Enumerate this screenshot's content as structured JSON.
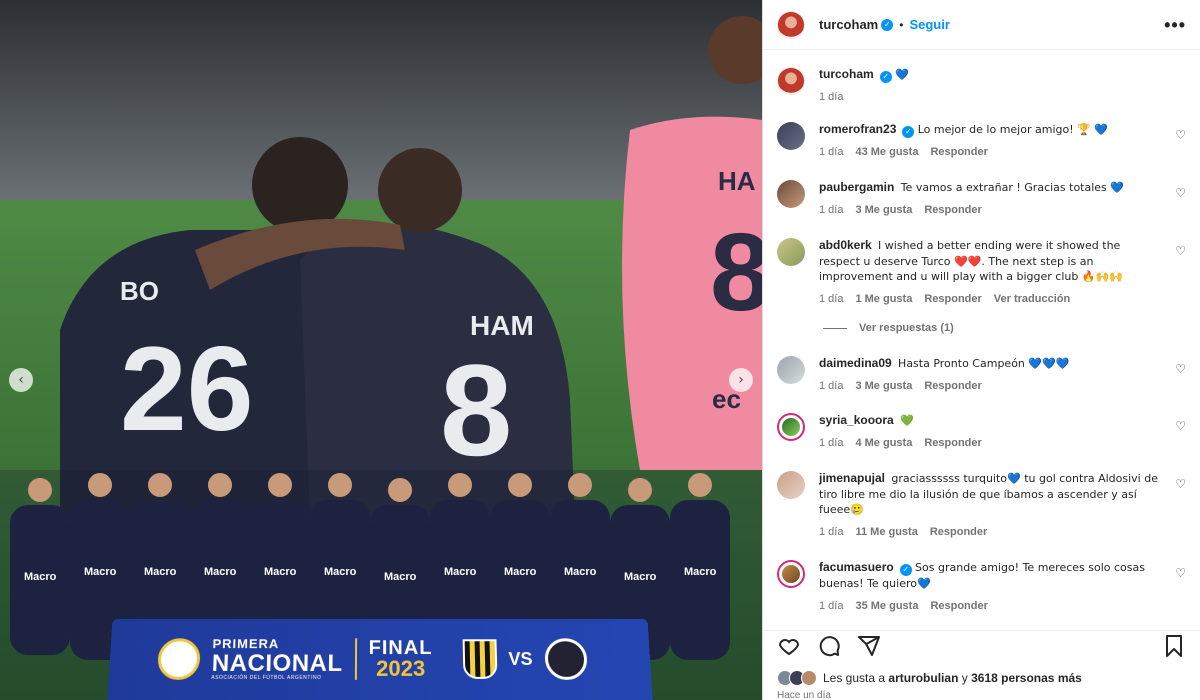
{
  "post": {
    "author": "turcoham",
    "follow_label": "Seguir",
    "more_label": "•••",
    "dot": "•",
    "verified_mark": "✓"
  },
  "media": {
    "prev_arrow": "‹",
    "next_arrow": "›",
    "jersey_left_number": "26",
    "jersey_right_number": "8",
    "jersey_right_name": "HAM",
    "jersey_left_name": "BO",
    "pink_jersey_name": "HA",
    "pink_jersey_number": "8",
    "pink_sponsor": "ec",
    "shirt_sponsor": "Macro",
    "banner": {
      "line1": "PRIMERA",
      "line2": "NACIONAL",
      "line3": "ASOCIACIÓN DEL FÚTBOL ARGENTINO",
      "final": "FINAL",
      "year": "2023",
      "vs": "VS"
    }
  },
  "caption": {
    "username": "turcoham",
    "text": "💙",
    "time": "1 día"
  },
  "comments": [
    {
      "username": "romerofran23",
      "verified": true,
      "text": "Lo mejor de lo mejor amigo! 🏆 💙",
      "time": "1 día",
      "likes": "43 Me gusta",
      "reply": "Responder",
      "extra": ""
    },
    {
      "username": "paubergamin",
      "verified": false,
      "text": "Te vamos a extrañar ! Gracias totales 💙",
      "time": "1 día",
      "likes": "3 Me gusta",
      "reply": "Responder",
      "extra": ""
    },
    {
      "username": "abd0kerk",
      "verified": false,
      "text": "I wished a better ending were it showed the respect u deserve Turco ❤️❤️. The next step is an improvement and u will play with a bigger club 🔥🙌🙌",
      "time": "1 día",
      "likes": "1 Me gusta",
      "reply": "Responder",
      "extra": "Ver traducción"
    },
    {
      "username": "daimedina09",
      "verified": false,
      "text": "Hasta Pronto Campeón 💙💙💙",
      "time": "1 día",
      "likes": "3 Me gusta",
      "reply": "Responder",
      "extra": ""
    },
    {
      "username": "syria_kooora",
      "verified": false,
      "text": "💚",
      "time": "1 día",
      "likes": "4 Me gusta",
      "reply": "Responder",
      "extra": ""
    },
    {
      "username": "jimenapujal",
      "verified": false,
      "text": "graciassssss turquito💙 tu gol contra Aldosivi de tiro libre me dio la ilusión de que íbamos a ascender y así fueee🥲",
      "time": "1 día",
      "likes": "11 Me gusta",
      "reply": "Responder",
      "extra": ""
    },
    {
      "username": "facumasuero",
      "verified": true,
      "text": "Sos grande amigo! Te mereces solo cosas buenas! Te quiero💙",
      "time": "1 día",
      "likes": "35 Me gusta",
      "reply": "Responder",
      "extra": ""
    }
  ],
  "replies_label": "Ver respuestas (1)",
  "comment_like_icon": "♡",
  "likes_summary": {
    "prefix": "Les gusta a",
    "user": "arturobulian",
    "mid": "y",
    "count": "3618 personas más"
  },
  "posted_ago": "Hace un día",
  "icons": {
    "like": "heart-icon",
    "comment": "comment-icon",
    "share": "share-icon",
    "save": "bookmark-icon"
  }
}
